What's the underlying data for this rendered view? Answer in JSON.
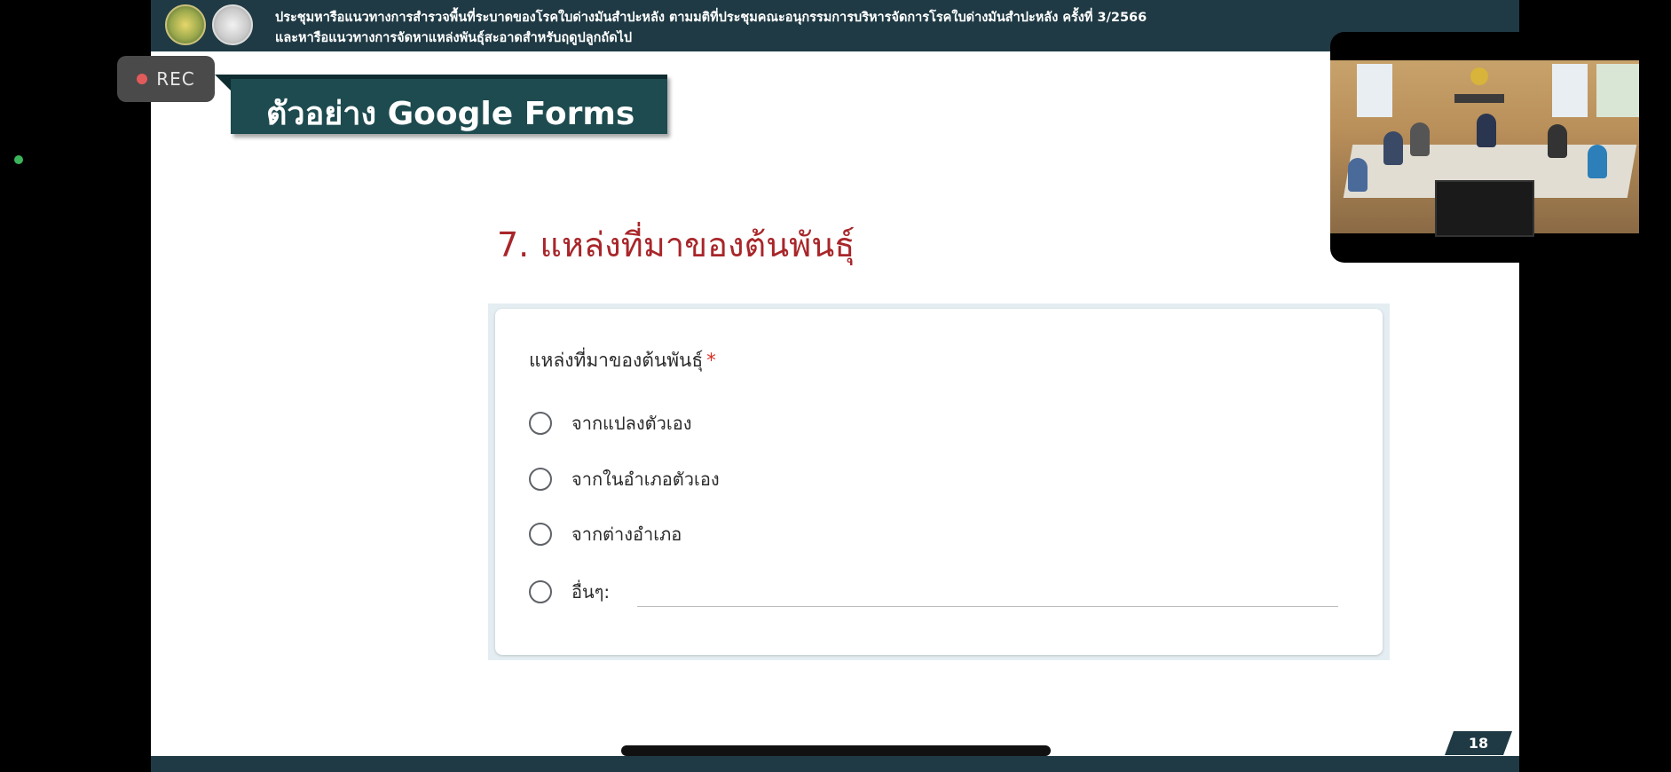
{
  "slide": {
    "header_line1": "ประชุมหารือแนวทางการสำรวจพื้นที่ระบาดของโรคใบด่างมันสำปะหลัง ตามมติที่ประชุมคณะอนุกรรมการบริหารจัดการโรคใบด่างมันสำปะหลัง ครั้งที่ 3/2566",
    "header_line2": "และหารือแนวทางการจัดหาแหล่งพันธุ์สะอาดสำหรับฤดูปลูกถัดไป",
    "title": "ตัวอย่าง Google Forms",
    "question_heading": "7. แหล่งที่มาของต้นพันธุ์",
    "page_number": "18"
  },
  "form": {
    "question_label": "แหล่งที่มาของต้นพันธุ์",
    "required_mark": "*",
    "options": [
      {
        "label": "จากแปลงตัวเอง"
      },
      {
        "label": "จากในอำเภอตัวเอง"
      },
      {
        "label": "จากต่างอำเภอ"
      },
      {
        "label": "อื่นๆ:"
      }
    ]
  },
  "recording": {
    "label": "REC"
  },
  "colors": {
    "header_bg": "#1f3a44",
    "title_bg": "#1d4b4f",
    "heading_red": "#a8262a",
    "required_red": "#d93025",
    "rec_dot": "#e25b5b"
  }
}
